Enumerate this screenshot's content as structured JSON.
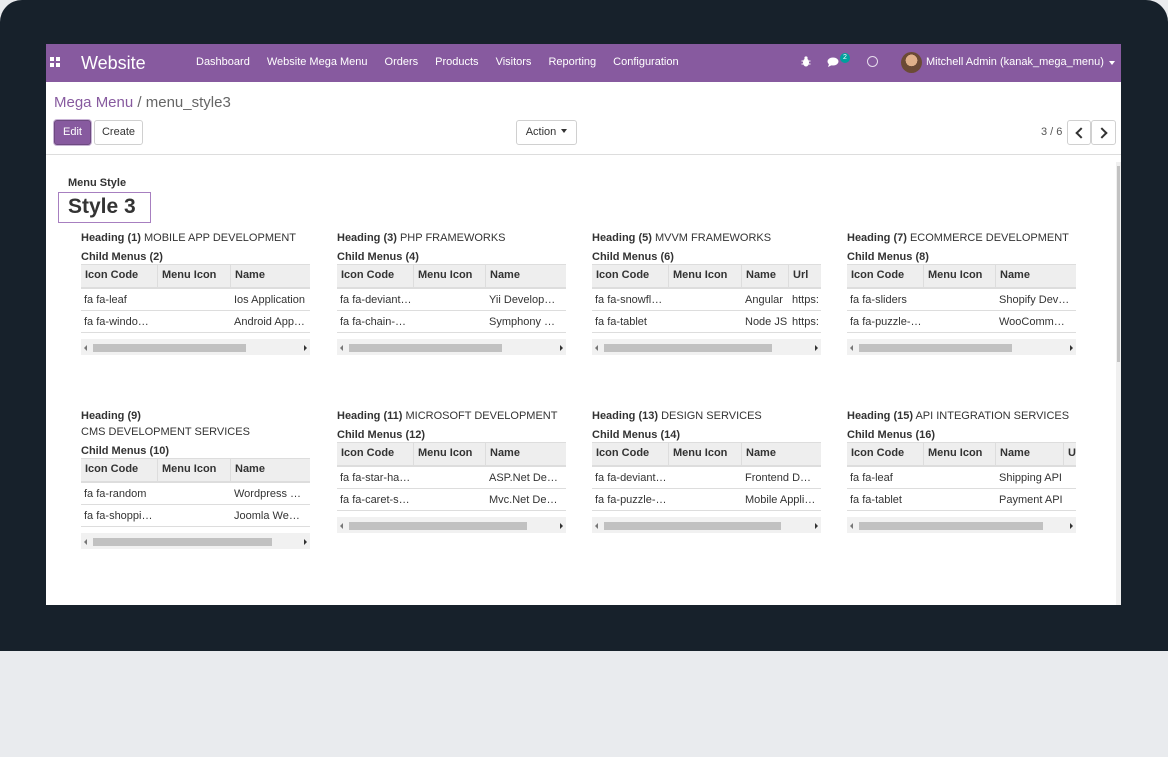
{
  "navbar": {
    "brand": "Website",
    "menu": [
      "Dashboard",
      "Website Mega Menu",
      "Orders",
      "Products",
      "Visitors",
      "Reporting",
      "Configuration"
    ],
    "chat_badge": "2",
    "user": "Mitchell Admin (kanak_mega_menu)",
    "bg_color": "#875a9f"
  },
  "breadcrumb": {
    "parent": "Mega Menu",
    "separator": "/",
    "current": "menu_style3"
  },
  "buttons": {
    "edit": "Edit",
    "create": "Create",
    "action": "Action"
  },
  "pager": {
    "text": "3 / 6"
  },
  "form": {
    "menu_style_label": "Menu Style",
    "menu_style_value": "Style 3",
    "blocks": [
      {
        "heading_label": "Heading (1)",
        "heading": "MOBILE APP DEVELOPMENT",
        "child_label": "Child Menus (2)",
        "columns": [
          "Icon Code",
          "Menu Icon",
          "Name"
        ],
        "rows": [
          [
            "fa fa-leaf",
            "",
            "Ios Application"
          ],
          [
            "fa fa-windo…",
            "",
            "Android App…"
          ]
        ]
      },
      {
        "heading_label": "Heading (3)",
        "heading": "PHP FRAMEWORKS",
        "child_label": "Child Menus (4)",
        "columns": [
          "Icon Code",
          "Menu Icon",
          "Name"
        ],
        "rows": [
          [
            "fa fa-deviant…",
            "",
            "Yii Develop…"
          ],
          [
            "fa fa-chain-…",
            "",
            "Symphony …"
          ]
        ]
      },
      {
        "heading_label": "Heading (5)",
        "heading": "MVVM FRAMEWORKS",
        "child_label": "Child Menus (6)",
        "columns": [
          "Icon Code",
          "Menu Icon",
          "Name",
          "Url"
        ],
        "rows": [
          [
            "fa fa-snowfl…",
            "",
            "Angular",
            "https:"
          ],
          [
            "fa fa-tablet",
            "",
            "Node JS",
            "https:"
          ]
        ]
      },
      {
        "heading_label": "Heading (7)",
        "heading": "ECOMMERCE DEVELOPMENT",
        "child_label": "Child Menus (8)",
        "columns": [
          "Icon Code",
          "Menu Icon",
          "Name"
        ],
        "rows": [
          [
            "fa fa-sliders",
            "",
            "Shopify Dev…"
          ],
          [
            "fa fa-puzzle-…",
            "",
            "WooComm…"
          ]
        ]
      },
      {
        "heading_label": "Heading (9)",
        "heading": "CMS DEVELOPMENT SERVICES",
        "child_label": "Child Menus (10)",
        "columns": [
          "Icon Code",
          "Menu Icon",
          "Name"
        ],
        "rows": [
          [
            "fa fa-random",
            "",
            "Wordpress …"
          ],
          [
            "fa fa-shoppi…",
            "",
            "Joomla We…"
          ]
        ]
      },
      {
        "heading_label": "Heading (11)",
        "heading": "MICROSOFT DEVELOPMENT",
        "child_label": "Child Menus (12)",
        "columns": [
          "Icon Code",
          "Menu Icon",
          "Name"
        ],
        "rows": [
          [
            "fa fa-star-ha…",
            "",
            "ASP.Net De…"
          ],
          [
            "fa fa-caret-s…",
            "",
            "Mvc.Net De…"
          ]
        ]
      },
      {
        "heading_label": "Heading (13)",
        "heading": "DESIGN SERVICES",
        "child_label": "Child Menus (14)",
        "columns": [
          "Icon Code",
          "Menu Icon",
          "Name"
        ],
        "rows": [
          [
            "fa fa-deviant…",
            "",
            "Frontend D…"
          ],
          [
            "fa fa-puzzle-…",
            "",
            "Mobile Appli…"
          ]
        ]
      },
      {
        "heading_label": "Heading (15)",
        "heading": "API INTEGRATION SERVICES",
        "child_label": "Child Menus (16)",
        "columns": [
          "Icon Code",
          "Menu Icon",
          "Name",
          "U"
        ],
        "rows": [
          [
            "fa fa-leaf",
            "",
            "Shipping API",
            ""
          ],
          [
            "fa fa-tablet",
            "",
            "Payment API",
            ""
          ]
        ]
      }
    ]
  }
}
